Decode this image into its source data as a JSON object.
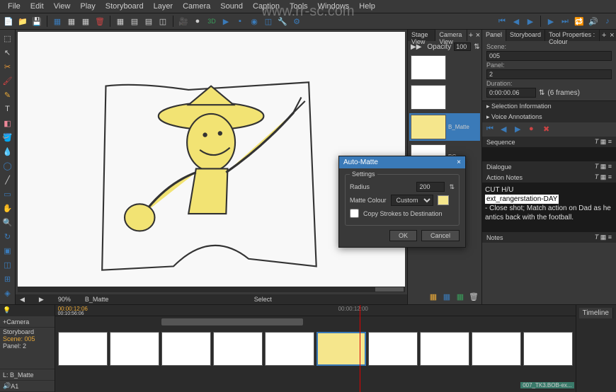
{
  "menu": [
    "File",
    "Edit",
    "View",
    "Play",
    "Storyboard",
    "Layer",
    "Camera",
    "Sound",
    "Caption",
    "Tools",
    "Windows",
    "Help"
  ],
  "watermark": "www.rr-sc.com",
  "toolbar3d": "3D",
  "canvas": {
    "zoom": "90%",
    "layer": "B_Matte",
    "mode": "Select"
  },
  "stage": {
    "tabs": [
      "Stage View",
      "Camera View"
    ],
    "opacity_label": "Opacity",
    "opacity_value": "100",
    "thumbs": [
      {
        "name": ""
      },
      {
        "name": ""
      },
      {
        "name": "B_Matte",
        "selected": true
      },
      {
        "name": "BG"
      }
    ]
  },
  "panel": {
    "tabs": [
      "Panel",
      "Storyboard",
      "Tool Properties : Colour"
    ],
    "scene_label": "Scene:",
    "scene_value": "005",
    "panel_label": "Panel:",
    "panel_value": "2",
    "duration_label": "Duration:",
    "duration_value": "0:00:00.06",
    "duration_frames": "(6 frames)",
    "sel_info": "Selection Information",
    "voice_ann": "Voice Annotations",
    "sequence_label": "Sequence",
    "dialogue_label": "Dialogue",
    "action_label": "Action Notes",
    "notes_label": "Notes",
    "action_text1": "CUT H/U",
    "action_text2": "ext_rangerstation-DAY",
    "action_text3": "- Close shot; Match action on Dad as he antics back with the football."
  },
  "dialog": {
    "title": "Auto-Matte",
    "settings": "Settings",
    "radius_label": "Radius",
    "radius_value": "200",
    "colour_label": "Matte Colour",
    "colour_mode": "Custom",
    "copy_label": "Copy Strokes to Destination",
    "ok": "OK",
    "cancel": "Cancel"
  },
  "timeline": {
    "label": "Timeline",
    "tc_current": "00:00:12:06",
    "tc_end": "00:10:56:06",
    "ruler": [
      "00:00:12:00"
    ],
    "camera": "Camera",
    "storyboard": "Storyboard",
    "scene_row": "Scene: 005",
    "panel_row": "Panel: 2",
    "layer_row": "L: B_Matte",
    "audio_row": "A1",
    "clip": "007_TK3.BOB-ex..."
  }
}
